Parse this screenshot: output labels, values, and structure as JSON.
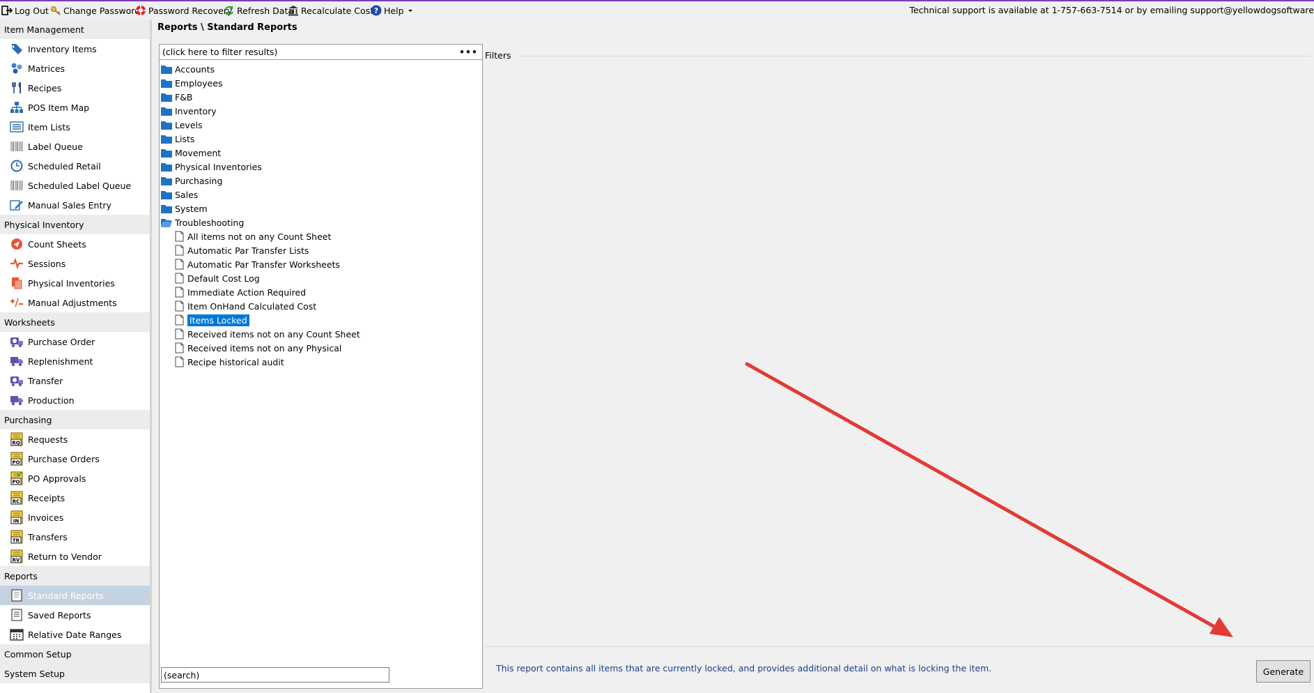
{
  "toolbar": {
    "logout": "Log Out",
    "change_password": "Change Password",
    "password_recovery": "Password Recovery",
    "refresh": "Refresh Data",
    "recalculate": "Recalculate Costs",
    "help": "Help",
    "support": "Technical support is available at 1-757-663-7514 or by emailing support@yellowdogsoftware"
  },
  "sidebar": {
    "items": [
      {
        "type": "header",
        "label": "Item Management"
      },
      {
        "type": "item",
        "label": "Inventory Items",
        "icon": "tag-icon"
      },
      {
        "type": "item",
        "label": "Matrices",
        "icon": "matrix-icon"
      },
      {
        "type": "item",
        "label": "Recipes",
        "icon": "fork-knife-icon"
      },
      {
        "type": "item",
        "label": "POS Item Map",
        "icon": "hierarchy-icon"
      },
      {
        "type": "item",
        "label": "Item Lists",
        "icon": "list-icon"
      },
      {
        "type": "item",
        "label": "Label Queue",
        "icon": "barcode-icon"
      },
      {
        "type": "item",
        "label": "Scheduled Retail",
        "icon": "clock-icon"
      },
      {
        "type": "item",
        "label": "Scheduled Label Queue",
        "icon": "barcode-icon"
      },
      {
        "type": "item",
        "label": "Manual Sales Entry",
        "icon": "edit-icon"
      },
      {
        "type": "header",
        "label": "Physical Inventory"
      },
      {
        "type": "item",
        "label": "Count Sheets",
        "icon": "count-sheets-icon"
      },
      {
        "type": "item",
        "label": "Sessions",
        "icon": "sessions-icon"
      },
      {
        "type": "item",
        "label": "Physical Inventories",
        "icon": "physical-inventories-icon"
      },
      {
        "type": "item",
        "label": "Manual Adjustments",
        "icon": "plus-minus-icon"
      },
      {
        "type": "header",
        "label": "Worksheets"
      },
      {
        "type": "item",
        "label": "Purchase Order",
        "icon": "worksheet-icon"
      },
      {
        "type": "item",
        "label": "Replenishment",
        "icon": "truck-icon"
      },
      {
        "type": "item",
        "label": "Transfer",
        "icon": "worksheet-icon"
      },
      {
        "type": "item",
        "label": "Production",
        "icon": "truck-icon"
      },
      {
        "type": "header",
        "label": "Purchasing"
      },
      {
        "type": "item",
        "label": "Requests",
        "icon": "doc-badge-icon",
        "badge": "RQ"
      },
      {
        "type": "item",
        "label": "Purchase Orders",
        "icon": "doc-badge-icon",
        "badge": "PO"
      },
      {
        "type": "item",
        "label": "PO Approvals",
        "icon": "doc-badge-icon",
        "badge": "PO"
      },
      {
        "type": "item",
        "label": "Receipts",
        "icon": "doc-badge-icon",
        "badge": "RC"
      },
      {
        "type": "item",
        "label": "Invoices",
        "icon": "doc-badge-icon",
        "badge": "IN"
      },
      {
        "type": "item",
        "label": "Transfers",
        "icon": "doc-badge-icon",
        "badge": "TR"
      },
      {
        "type": "item",
        "label": "Return to Vendor",
        "icon": "doc-badge-icon",
        "badge": "RV"
      },
      {
        "type": "header",
        "label": "Reports"
      },
      {
        "type": "item",
        "label": "Standard Reports",
        "icon": "report-icon",
        "active": true
      },
      {
        "type": "item",
        "label": "Saved Reports",
        "icon": "saved-report-icon"
      },
      {
        "type": "item",
        "label": "Relative Date Ranges",
        "icon": "calendar-icon"
      },
      {
        "type": "header",
        "label": "Common Setup"
      },
      {
        "type": "header",
        "label": "System Setup"
      }
    ]
  },
  "breadcrumb": "Reports \\ Standard Reports",
  "filter_placeholder": "(click here to filter results)",
  "filter_menu": "•••",
  "tree": {
    "folders": [
      "Accounts",
      "Employees",
      "F&B",
      "Inventory",
      "Levels",
      "Lists",
      "Movement",
      "Physical Inventories",
      "Purchasing",
      "Sales",
      "System"
    ],
    "open_folder": "Troubleshooting",
    "reports": [
      "All items not on any Count Sheet",
      "Automatic Par Transfer Lists",
      "Automatic Par Transfer Worksheets",
      "Default Cost Log",
      "Immediate Action Required",
      "Item OnHand Calculated Cost",
      "Items Locked",
      "Received items not on any Count Sheet",
      "Received items not on any Physical",
      "Recipe historical audit"
    ],
    "selected": "Items Locked"
  },
  "search_placeholder": "(search)",
  "filters_label": "Filters",
  "description": "This report contains all items that are currently locked, and provides additional detail on what is locking the item.",
  "generate_label": "Generate",
  "colors": {
    "accent": "#0078d7",
    "annotation_arrow": "#e53935",
    "description_text": "#1a3f8a",
    "folder": "#1e72c8"
  }
}
